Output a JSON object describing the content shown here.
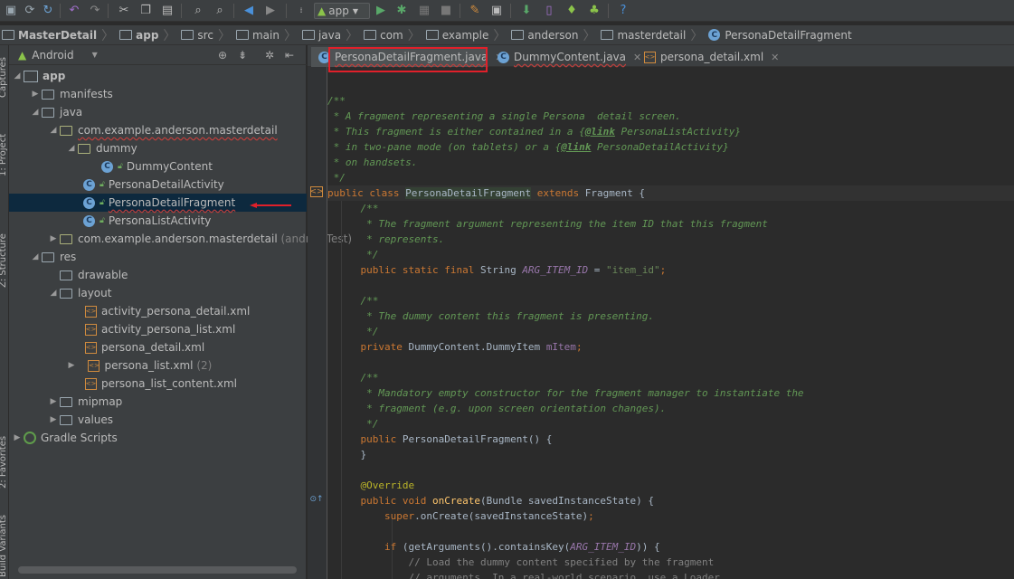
{
  "toolbar": {
    "run_config": "app",
    "icons": [
      "save-icon",
      "sync-icon",
      "undo-icon",
      "redo-icon",
      "cut-icon",
      "copy-icon",
      "paste-icon",
      "find-icon",
      "replace-icon",
      "back-icon",
      "forward-icon",
      "make-icon",
      "run-icon",
      "debug-icon",
      "attach-icon",
      "stop-icon",
      "project-structure-icon",
      "sdk-manager-icon",
      "avd-manager-icon",
      "android-device-monitor-icon",
      "help-icon"
    ]
  },
  "breadcrumb": [
    "MasterDetail",
    "app",
    "src",
    "main",
    "java",
    "com",
    "example",
    "anderson",
    "masterdetail",
    "PersonaDetailFragment"
  ],
  "side_strip": {
    "captures": "Captures",
    "project": "1: Project",
    "structure": "Z: Structure",
    "favorites": "2: Favorites",
    "build_variants": "Build Variants"
  },
  "project_panel": {
    "view": "Android",
    "tree": [
      {
        "label": "app",
        "type": "app"
      },
      {
        "label": "manifests",
        "type": "folder"
      },
      {
        "label": "java",
        "type": "folder"
      },
      {
        "label": "com.example.anderson.masterdetail",
        "type": "package"
      },
      {
        "label": "dummy",
        "type": "package"
      },
      {
        "label": "DummyContent",
        "type": "class"
      },
      {
        "label": "PersonaDetailActivity",
        "type": "class"
      },
      {
        "label": "PersonaDetailFragment",
        "type": "class"
      },
      {
        "label": "PersonaListActivity",
        "type": "class"
      },
      {
        "label": "com.example.anderson.masterdetail",
        "suffix": "(androidTest)",
        "type": "package"
      },
      {
        "label": "res",
        "type": "folder"
      },
      {
        "label": "drawable",
        "type": "folder"
      },
      {
        "label": "layout",
        "type": "folder"
      },
      {
        "label": "activity_persona_detail.xml",
        "type": "xml"
      },
      {
        "label": "activity_persona_list.xml",
        "type": "xml"
      },
      {
        "label": "persona_detail.xml",
        "type": "xml"
      },
      {
        "label": "persona_list.xml",
        "suffix": "(2)",
        "type": "xml"
      },
      {
        "label": "persona_list_content.xml",
        "type": "xml"
      },
      {
        "label": "mipmap",
        "type": "folder"
      },
      {
        "label": "values",
        "type": "folder"
      },
      {
        "label": "Gradle Scripts",
        "type": "gradle"
      }
    ]
  },
  "tabs": [
    {
      "label": "PersonaDetailFragment.java",
      "icon": "C"
    },
    {
      "label": "DummyContent.java",
      "icon": "C"
    },
    {
      "label": "persona_detail.xml",
      "icon": "xml"
    }
  ],
  "colors": {
    "highlight": "#e0202a",
    "keyword": "#cc7832",
    "doc_comment": "#629755",
    "field": "#9876aa"
  },
  "code": {
    "l0": "/**",
    "l1a": " * A fragment representing a single Persona  detail screen.",
    "l2a": " * This fragment is either contained in a {",
    "l2b": "@link",
    "l2c": " PersonaListActivity}",
    "l3a": " * in two-pane mode (on tablets) or a {",
    "l3b": "@link",
    "l3c": " PersonaDetailActivity}",
    "l4": " * on handsets.",
    "l5": " */",
    "l6a": "public class ",
    "l6b": "PersonaDetailFragment",
    "l6c": " extends ",
    "l6d": "Fragment {",
    "l7": "    /**",
    "l8": "     * The fragment argument representing the item ID that this fragment",
    "l9": "     * represents.",
    "l10": "     */",
    "l11a": "    public static final ",
    "l11b": "String ",
    "l11c": "ARG_ITEM_ID",
    "l11d": " = ",
    "l11e": "\"item_id\"",
    "l11f": ";",
    "l12": "    /**",
    "l13": "     * The dummy content this fragment is presenting.",
    "l14": "     */",
    "l15a": "    private ",
    "l15b": "DummyContent.DummyItem ",
    "l15c": "mItem",
    "l15d": ";",
    "l16": "    /**",
    "l17": "     * Mandatory empty constructor for the fragment manager to instantiate the",
    "l18": "     * fragment (e.g. upon screen orientation changes).",
    "l19": "     */",
    "l20a": "    public ",
    "l20b": "PersonaDetailFragment() {",
    "l21": "    }",
    "l22": "    @Override",
    "l23a": "    public void ",
    "l23b": "onCreate",
    "l23c": "(Bundle savedInstanceState) {",
    "l24a": "        super",
    "l24b": ".onCreate(savedInstanceState)",
    "l24c": ";",
    "l25a": "        if ",
    "l25b": "(getArguments().containsKey(",
    "l25c": "ARG_ITEM_ID",
    "l25d": ")) {",
    "l26": "            // Load the dummy content specified by the fragment",
    "l27": "            // arguments. In a real-world scenario, use a Loader"
  }
}
